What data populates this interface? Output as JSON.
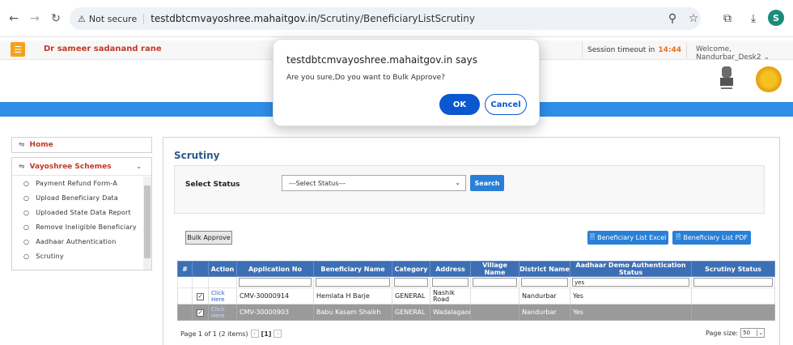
{
  "browser": {
    "security_label": "Not secure",
    "url_host": "testdbtcmvayoshree.mahaitgov.in",
    "url_path": "/Scrutiny/BeneficiaryListScrutiny",
    "profile_initial": "S"
  },
  "topbar": {
    "user_name": "Dr sameer sadanand rane",
    "session_label": "Session timeout in",
    "session_time": "14:44",
    "welcome": "Welcome, Nandurbar_Desk2"
  },
  "sidebar": {
    "home": "Home",
    "group_title": "Vayoshree Schemes",
    "items": [
      "Payment Refund Form-A",
      "Upload Beneficiary Data",
      "Uploaded State Data Report",
      "Remove Ineligible Beneficiary",
      "Aadhaar Authentication",
      "Scrutiny"
    ]
  },
  "main": {
    "title": "Scrutiny",
    "filter_label": "Select Status",
    "status_placeholder": "---Select Status---",
    "search_label": "Search",
    "bulk_label": "Bulk Approve",
    "excel_label": "Beneficiary List Excel",
    "pdf_label": "Beneficiary List PDF"
  },
  "grid": {
    "headers": [
      "#",
      "",
      "Action",
      "Application No",
      "Beneficiary Name",
      "Category",
      "Address",
      "Village Name",
      "District Name",
      "Aadhaar Demo Authentication Status",
      "Scrutiny Status"
    ],
    "aadhaar_filter": "yes",
    "action_link": "Click Here",
    "rows": [
      {
        "app_no": "CMV-30000914",
        "name": "Hemlata H Barje",
        "category": "GENERAL",
        "address": "Nashik Road",
        "village": "",
        "district": "Nandurbar",
        "aadhaar": "Yes",
        "scrutiny": ""
      },
      {
        "app_no": "CMV-30000903",
        "name": "Babu Kasam Shaikh",
        "category": "GENERAL",
        "address": "Wadalagaon",
        "village": "",
        "district": "Nandurbar",
        "aadhaar": "Yes",
        "scrutiny": ""
      }
    ],
    "pager_text": "Page 1 of 1 (2 items)",
    "current_page": "[1]",
    "page_size_label": "Page size:",
    "page_size": "50"
  },
  "dialog": {
    "title": "testdbtcmvayoshree.mahaitgov.in says",
    "message": "Are you sure,Do you want to Bulk Approve?",
    "ok": "OK",
    "cancel": "Cancel"
  }
}
